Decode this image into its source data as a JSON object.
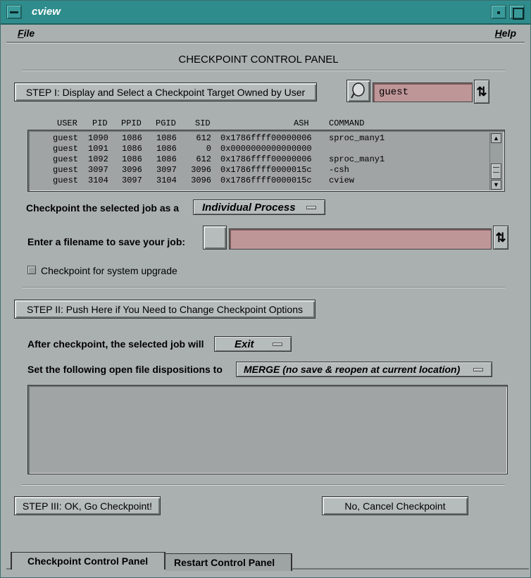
{
  "window": {
    "title": "cview"
  },
  "menubar": {
    "file": "File",
    "help": "Help"
  },
  "panel": {
    "title": "CHECKPOINT CONTROL PANEL"
  },
  "step1": {
    "button_label": "STEP I: Display and Select a Checkpoint Target Owned by User",
    "user_field_value": "guest"
  },
  "table": {
    "headers": [
      "USER",
      "PID",
      "PPID",
      "PGID",
      "SID",
      "ASH",
      "COMMAND"
    ],
    "rows": [
      [
        "guest",
        "1090",
        "1086",
        "1086",
        "612",
        "0x1786ffff00000006",
        "sproc_many1"
      ],
      [
        "guest",
        "1091",
        "1086",
        "1086",
        "0",
        "0x0000000000000000",
        ""
      ],
      [
        "guest",
        "1092",
        "1086",
        "1086",
        "612",
        "0x1786ffff00000006",
        "sproc_many1"
      ],
      [
        "guest",
        "3097",
        "3096",
        "3097",
        "3096",
        "0x1786ffff0000015c",
        "-csh"
      ],
      [
        "guest",
        "3104",
        "3097",
        "3104",
        "3096",
        "0x1786ffff0000015c",
        "cview"
      ]
    ]
  },
  "checkpoint_as": {
    "label": "Checkpoint the selected job as a",
    "value": "Individual Process"
  },
  "filename": {
    "label": "Enter a filename to save your job:",
    "value": ""
  },
  "upgrade": {
    "label": "Checkpoint for system upgrade",
    "checked": false
  },
  "step2": {
    "button_label": "STEP II: Push Here if You Need to Change Checkpoint Options"
  },
  "after_checkpoint": {
    "label": "After checkpoint, the selected job will",
    "value": "Exit"
  },
  "file_dispositions": {
    "label": "Set the following open file dispositions to",
    "value": "MERGE (no save & reopen at current location)"
  },
  "step3": {
    "button_label": "STEP III: OK, Go Checkpoint!"
  },
  "cancel": {
    "button_label": "No, Cancel Checkpoint"
  },
  "tabs": [
    {
      "label": "Checkpoint Control Panel",
      "active": true
    },
    {
      "label": "Restart Control Panel",
      "active": false
    }
  ]
}
